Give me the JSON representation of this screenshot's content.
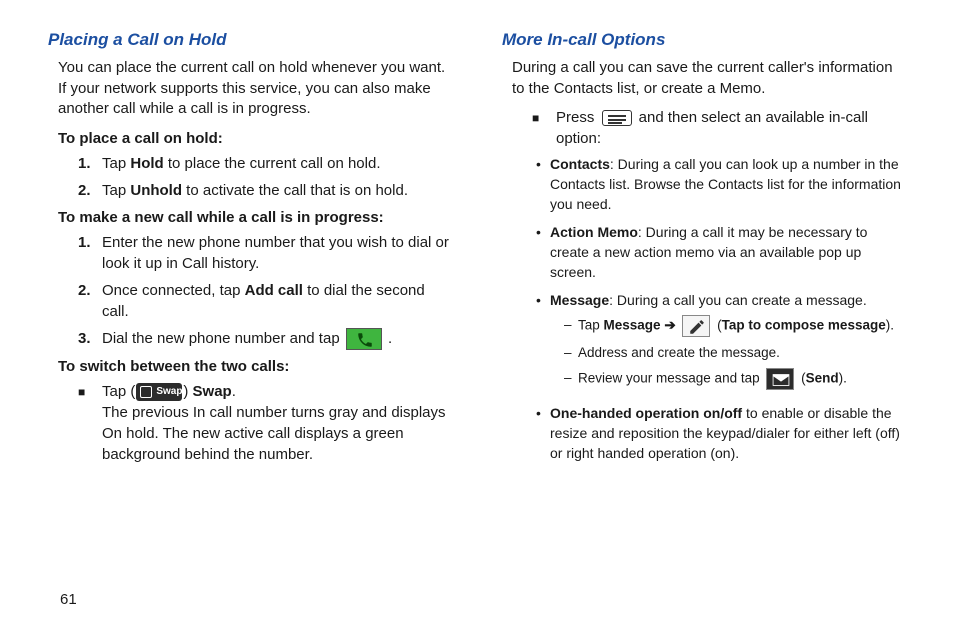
{
  "page_number": "61",
  "left": {
    "heading": "Placing a Call on Hold",
    "intro": "You can place the current call on hold whenever you want. If your network supports this service, you can also make another call while a call is in progress.",
    "sub1": "To place a call on hold:",
    "s1_steps": {
      "n1": "1.",
      "t1a": "Tap ",
      "t1b": "Hold",
      "t1c": " to place the current call on hold.",
      "n2": "2.",
      "t2a": "Tap ",
      "t2b": "Unhold",
      "t2c": " to activate the call that is on hold."
    },
    "sub2": "To make a new call while a call is in progress:",
    "s2_steps": {
      "n1": "1.",
      "t1": "Enter the new phone number that you wish to dial or look it up in Call history.",
      "n2": "2.",
      "t2a": "Once connected, tap ",
      "t2b": "Add call",
      "t2c": " to dial the second call.",
      "n3": "3.",
      "t3a": "Dial the new phone number and tap ",
      "t3c": "."
    },
    "sub3": "To switch between the two calls:",
    "swap_label": "Swap",
    "s3_tap": "Tap (",
    "s3_tap_end": ") ",
    "s3_bold": "Swap",
    "s3_period": ".",
    "s3_desc": "The previous In call number turns gray and displays On hold. The new active call displays a green background behind the number."
  },
  "right": {
    "heading": "More In-call Options",
    "intro": "During a call you can save the current caller's information to the Contacts list, or create a Memo.",
    "press_a": "Press ",
    "press_b": " and then select an available in-call option:",
    "b1_bold": "Contacts",
    "b1_text": ": During a call you can look up a number in the Contacts list. Browse the Contacts list for the information you need.",
    "b2_bold": "Action Memo",
    "b2_text": ": During a call it may be necessary to create a new action memo via an available pop up screen.",
    "b3_bold": "Message",
    "b3_text": ": During a call you can create a message.",
    "d1_a": "Tap ",
    "d1_b": "Message ➔",
    "d1_c": " (",
    "d1_d": "Tap to compose message",
    "d1_e": ").",
    "d2": "Address and create the message.",
    "d3_a": "Review your message and tap ",
    "d3_c": " (",
    "d3_d": "Send",
    "d3_e": ").",
    "b4_bold": "One-handed operation on/off",
    "b4_text": " to enable or disable the resize and reposition the keypad/dialer for either left (off) or right handed operation (on)."
  }
}
